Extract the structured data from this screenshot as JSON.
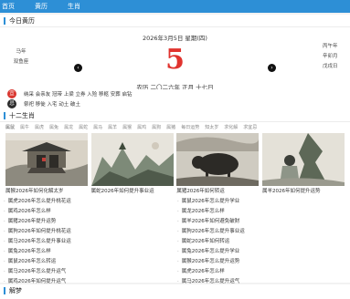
{
  "nav": {
    "items": [
      "首页",
      "黄历",
      "生肖"
    ]
  },
  "today": {
    "heading": "今日黄历",
    "date_line": "2026年3月5日 星期(四)",
    "left": [
      "马年",
      "双鱼座"
    ],
    "right": [
      "丙午年",
      "辛卯月",
      "戊戌日"
    ],
    "day": "5",
    "lunar": "农历 二〇二六年 正月 十七日",
    "prev_label": "‹",
    "next_label": "›"
  },
  "yiji": {
    "yi_badge": "宜",
    "yi_text": "纳采 会亲友 冠带 上梁 立券 入殓 移柩 安葬 启钻",
    "ji_badge": "忌",
    "ji_text": "祭祀 移徙 入宅 动土 破土"
  },
  "zodiac": {
    "heading": "十二生肖",
    "tabs": [
      "属鼠",
      "属牛",
      "属虎",
      "属兔",
      "属龙",
      "属蛇",
      "属马",
      "属羊",
      "属猴",
      "属鸡",
      "属狗",
      "属猪",
      "每日运势",
      "知太岁",
      "求化解",
      "求宜忌"
    ],
    "cards": [
      {
        "caption": "属猴2026年如何化解太岁"
      },
      {
        "caption": "属蛇2026年如何提升事业运"
      },
      {
        "caption": "属猪2026年如何转运"
      },
      {
        "caption": "属羊2026年如何提升运势"
      }
    ],
    "left_links": [
      "属虎2026年怎么提升桃花运",
      "属鸡2026年怎么样",
      "属猪2026年提升运势",
      "属狗2026年如何提升桃花运",
      "属马2026年怎么提升事业运",
      "属兔2026年怎么样",
      "属鼠2026年怎么转运",
      "属马2026年怎么提升运气",
      "属鸡2026年如何提升运气"
    ],
    "right_links": [
      "属鼠2026年怎么提升学业",
      "属龙2026年怎么样",
      "属羊2026年如何避免破财",
      "属狗2026年怎么提升事业运",
      "属蛇2026年如何转运",
      "属兔2026年怎么提升学业",
      "属猴2026年怎么提升运势",
      "属虎2026年怎么样",
      "属马2026年怎么提升运气"
    ]
  },
  "dream": {
    "heading": "解梦"
  },
  "colors": {
    "accent": "#2d8fd6",
    "day_red": "#e0332e",
    "yi_red": "#d9362f",
    "ji_black": "#2b2b2b"
  },
  "icons": {
    "prev": "chevron-left-icon",
    "next": "chevron-right-icon"
  }
}
